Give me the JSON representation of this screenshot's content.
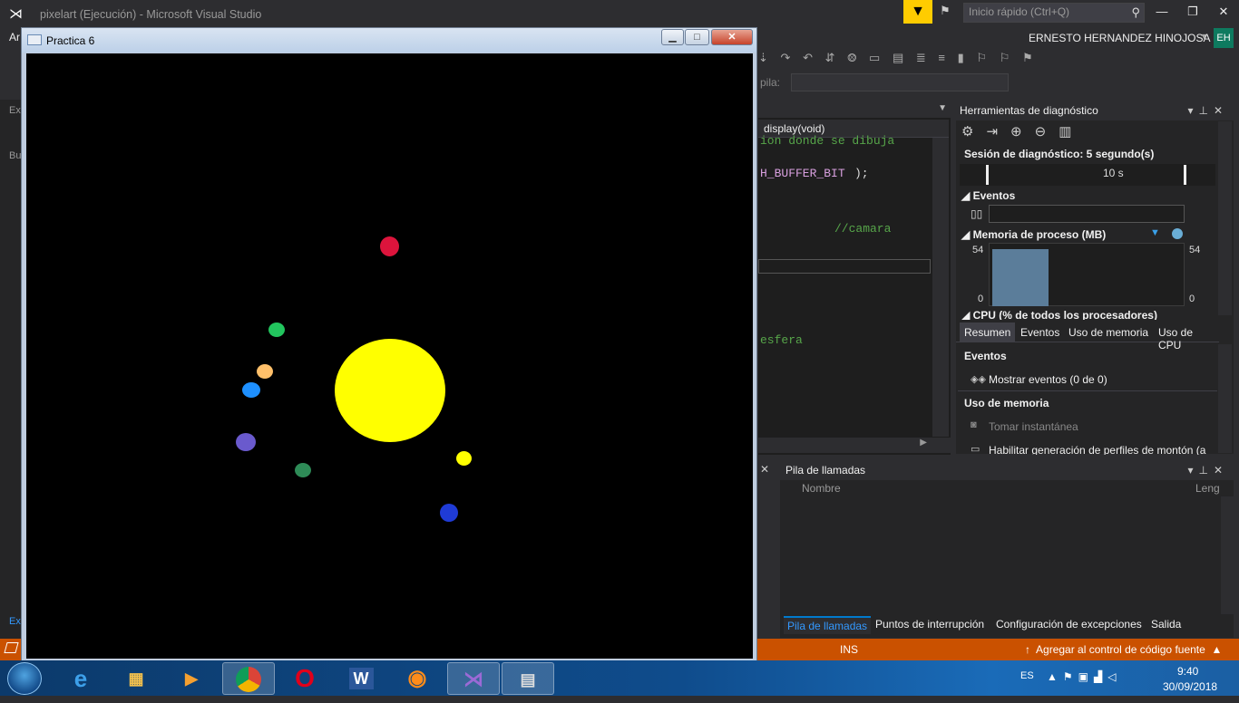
{
  "vs": {
    "title": "pixelart (Ejecución) - Microsoft Visual Studio",
    "quick_launch_placeholder": "Inicio rápido (Ctrl+Q)",
    "menu_fragment": "Ar",
    "user": "ERNESTO HERNANDEZ HINOJOSA",
    "user_initials": "EH",
    "stack_label": "pila:",
    "accent": "#ffcc00"
  },
  "left_strip": {
    "items": [
      "Ex",
      "Bu",
      "Ex"
    ]
  },
  "editor": {
    "function_dropdown": "display(void)",
    "code_lines": [
      "ion donde se dibuja",
      "H_BUFFER_BIT",
      ");",
      "//camara",
      "esfera"
    ]
  },
  "diagnostics": {
    "title": "Herramientas de diagnóstico",
    "session": "Sesión de diagnóstico: 5 segundo(s)",
    "timeline_label": "10 s",
    "events_title": "Eventos",
    "memory_title": "Memoria de proceso (MB)",
    "memory_max_left": "54",
    "memory_min_left": "0",
    "memory_max_right": "54",
    "memory_min_right": "0",
    "memory_usage_fraction": 0.97,
    "cpu_title": "CPU (% de todos los procesadores)",
    "tabs": [
      "Resumen",
      "Eventos",
      "Uso de memoria",
      "Uso de CPU"
    ],
    "summary": {
      "events_title": "Eventos",
      "show_events": "Mostrar eventos (0 de 0)",
      "memory_title": "Uso de memoria",
      "snapshot": "Tomar instantánea",
      "heap": "Habilitar generación de perfiles de montón (a"
    }
  },
  "callstack": {
    "title": "Pila de llamadas",
    "col_name": "Nombre",
    "col_lang": "Leng",
    "tabs": [
      "Pila de llamadas",
      "Puntos de interrupción",
      "Configuración de excepciones",
      "Salida"
    ]
  },
  "status": {
    "mode": "INS",
    "source_control": "Agregar al control de código fuente"
  },
  "practica": {
    "title": "Practica 6",
    "sun_color": "#ffff00",
    "planet_colors": [
      "#dc143c",
      "#22c55e",
      "#ffc06a",
      "#1e90ff",
      "#6a5acd",
      "#2e8b57",
      "#ffff00",
      "#1f3bd6"
    ]
  },
  "taskbar": {
    "apps": [
      "start-orb",
      "internet-explorer",
      "file-explorer",
      "media-player",
      "chrome",
      "opera",
      "word",
      "firefox-shield",
      "visual-studio",
      "practica-window"
    ],
    "language": "ES",
    "time": "9:40",
    "date": "30/09/2018"
  }
}
